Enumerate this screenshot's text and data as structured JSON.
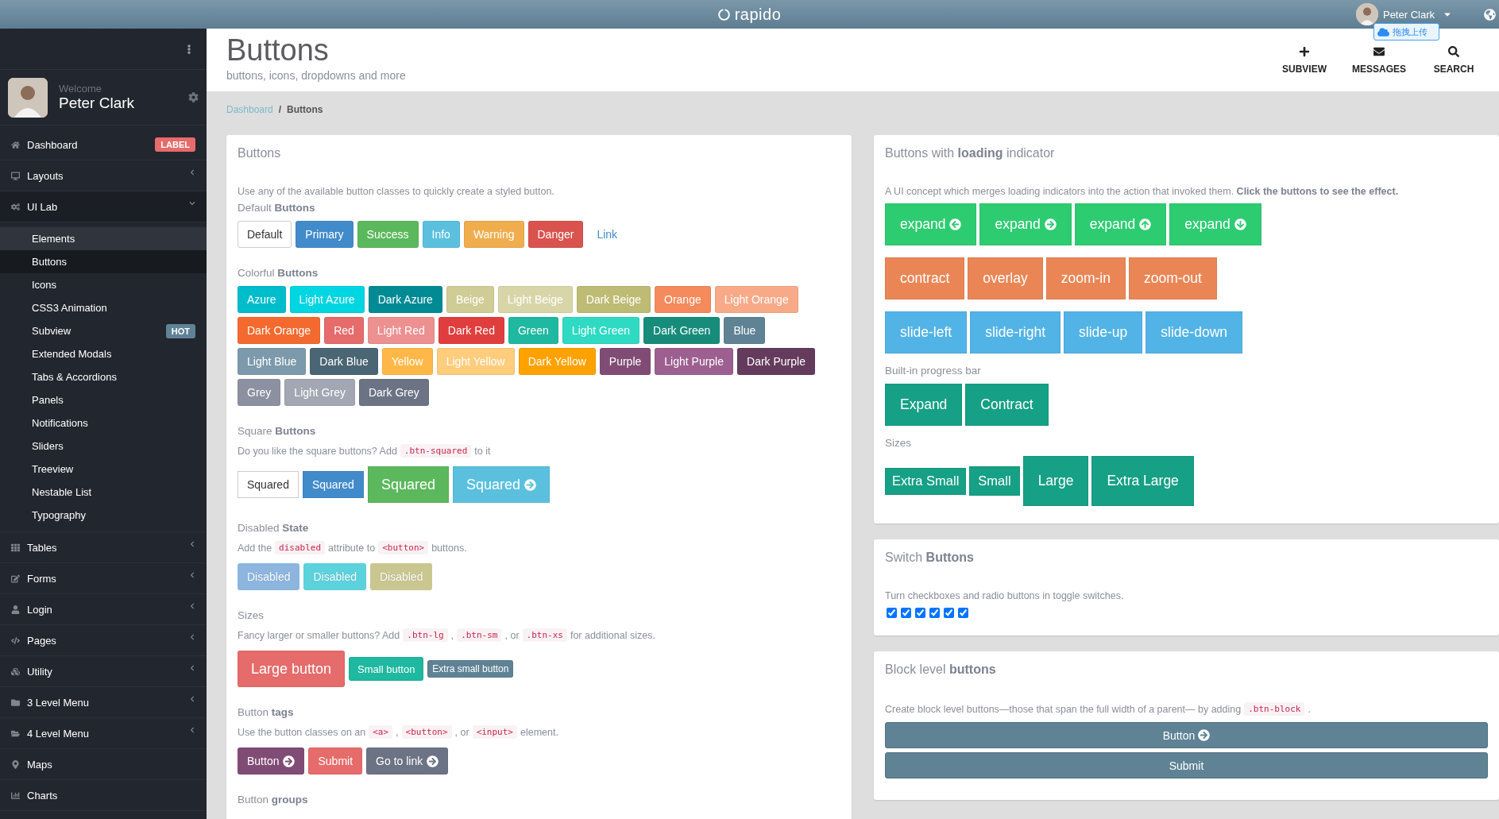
{
  "topbar": {
    "logo": "rapido",
    "user": "Peter Clark",
    "upload": "拖拽上传"
  },
  "sidebar": {
    "welcome": "Welcome",
    "user": "Peter Clark",
    "items": [
      {
        "label": "Dashboard",
        "badge": {
          "text": "LABEL",
          "color": "#e66b6b"
        }
      },
      {
        "label": "Layouts",
        "expanded": false
      },
      {
        "label": "UI Lab",
        "expanded": true,
        "children": [
          {
            "label": "Elements",
            "selected": false,
            "hovered": true
          },
          {
            "label": "Buttons",
            "selected": true,
            "hovered": false
          },
          {
            "label": "Icons",
            "selected": false,
            "hovered": false
          },
          {
            "label": "CSS3 Animation",
            "selected": false,
            "hovered": false
          },
          {
            "label": "Subview",
            "selected": false,
            "hovered": false,
            "badge": {
              "text": "HOT",
              "color": "#5f8295"
            }
          },
          {
            "label": "Extended Modals",
            "selected": false,
            "hovered": false
          },
          {
            "label": "Tabs & Accordions",
            "selected": false,
            "hovered": false
          },
          {
            "label": "Panels",
            "selected": false,
            "hovered": false
          },
          {
            "label": "Notifications",
            "selected": false,
            "hovered": false
          },
          {
            "label": "Sliders",
            "selected": false,
            "hovered": false
          },
          {
            "label": "Treeview",
            "selected": false,
            "hovered": false
          },
          {
            "label": "Nestable List",
            "selected": false,
            "hovered": false
          },
          {
            "label": "Typography",
            "selected": false,
            "hovered": false
          }
        ]
      },
      {
        "label": "Tables",
        "expanded": false
      },
      {
        "label": "Forms",
        "expanded": false
      },
      {
        "label": "Login",
        "expanded": false
      },
      {
        "label": "Pages",
        "expanded": false
      },
      {
        "label": "Utility",
        "expanded": false
      },
      {
        "label": "3 Level Menu",
        "expanded": false
      },
      {
        "label": "4 Level Menu",
        "expanded": false
      },
      {
        "label": "Maps"
      },
      {
        "label": "Charts"
      }
    ]
  },
  "header": {
    "title": "Buttons",
    "subtitle": "buttons, icons, dropdowns and more",
    "actions": [
      {
        "label": "SUBVIEW"
      },
      {
        "label": "MESSAGES"
      },
      {
        "label": "SEARCH"
      }
    ]
  },
  "breadcrumb": {
    "separator": "/",
    "items": [
      {
        "label": "Dashboard",
        "current": false
      },
      {
        "label": "Buttons",
        "current": true
      }
    ]
  },
  "columns": [
    [
      {
        "title": "Buttons",
        "intro": [
          {
            "kind": "text",
            "text": "Use any of the available button classes to quickly create a styled button."
          }
        ],
        "sections": [
          {
            "heading": "Default **Buttons**",
            "squared": false,
            "rows": [
              [
                {
                  "label": "Default",
                  "kind": "plain"
                },
                {
                  "label": "Primary",
                  "kind": "solid",
                  "color": "#428bca"
                },
                {
                  "label": "Success",
                  "kind": "solid",
                  "color": "#5cb85c"
                },
                {
                  "label": "Info",
                  "kind": "solid",
                  "color": "#5bc0de"
                },
                {
                  "label": "Warning",
                  "kind": "solid",
                  "color": "#f0ad4e"
                },
                {
                  "label": "Danger",
                  "kind": "solid",
                  "color": "#d9534f"
                },
                {
                  "label": "Link",
                  "kind": "link",
                  "color": "#428bca"
                }
              ]
            ]
          },
          {
            "heading": "Colorful **Buttons**",
            "squared": false,
            "rows": [
              [
                {
                  "label": "Azure",
                  "kind": "solid",
                  "color": "#00bdcc"
                },
                {
                  "label": "Light Azure",
                  "kind": "solid",
                  "color": "#00d5e2"
                },
                {
                  "label": "Dark Azure",
                  "kind": "solid",
                  "color": "#008b94"
                },
                {
                  "label": "Beige",
                  "kind": "solid",
                  "color": "#cfcc95"
                },
                {
                  "label": "Light Beige",
                  "kind": "solid",
                  "color": "#d8d6a8"
                },
                {
                  "label": "Dark Beige",
                  "kind": "solid",
                  "color": "#bebb74"
                },
                {
                  "label": "Orange",
                  "kind": "solid",
                  "color": "#f58a5c"
                },
                {
                  "label": "Light Orange",
                  "kind": "solid",
                  "color": "#f8aa88"
                }
              ],
              [
                {
                  "label": "Dark Orange",
                  "kind": "solid",
                  "color": "#f46a2e"
                },
                {
                  "label": "Red",
                  "kind": "solid",
                  "color": "#e66b6b"
                },
                {
                  "label": "Light Red",
                  "kind": "solid",
                  "color": "#ec9090"
                },
                {
                  "label": "Dark Red",
                  "kind": "solid",
                  "color": "#e03e3e"
                },
                {
                  "label": "Green",
                  "kind": "solid",
                  "color": "#1fb8a0"
                },
                {
                  "label": "Light Green",
                  "kind": "solid",
                  "color": "#2fdac3"
                },
                {
                  "label": "Dark Green",
                  "kind": "solid",
                  "color": "#178c7b"
                },
                {
                  "label": "Blue",
                  "kind": "solid",
                  "color": "#5f8295"
                }
              ],
              [
                {
                  "label": "Light Blue",
                  "kind": "solid",
                  "color": "#7c9aab"
                },
                {
                  "label": "Dark Blue",
                  "kind": "solid",
                  "color": "#4a6573"
                },
                {
                  "label": "Yellow",
                  "kind": "solid",
                  "color": "#ffb848"
                },
                {
                  "label": "Light Yellow",
                  "kind": "solid",
                  "color": "#ffcd7c"
                },
                {
                  "label": "Dark Yellow",
                  "kind": "solid",
                  "color": "#ffa200"
                },
                {
                  "label": "Purple",
                  "kind": "solid",
                  "color": "#804c75"
                },
                {
                  "label": "Light Purple",
                  "kind": "solid",
                  "color": "#9c5f90"
                },
                {
                  "label": "Dark Purple",
                  "kind": "solid",
                  "color": "#643b5c"
                }
              ],
              [
                {
                  "label": "Grey",
                  "kind": "solid",
                  "color": "#8b91a0"
                },
                {
                  "label": "Light Grey",
                  "kind": "solid",
                  "color": "#a2a7b3"
                },
                {
                  "label": "Dark Grey",
                  "kind": "solid",
                  "color": "#6c7385"
                }
              ]
            ]
          },
          {
            "heading": "Square **Buttons**",
            "note": [
              {
                "kind": "text",
                "text": "Do you like the square buttons? Add"
              },
              {
                "kind": "code",
                "text": ".btn-squared"
              },
              {
                "kind": "text",
                "text": "to it"
              }
            ],
            "squared": true,
            "rows": [
              [
                {
                  "label": "Squared",
                  "kind": "plain"
                },
                {
                  "label": "Squared",
                  "kind": "solid",
                  "color": "#428bca"
                },
                {
                  "label": "Squared",
                  "kind": "large",
                  "color": "#5cb85c"
                },
                {
                  "label": "Squared",
                  "kind": "largearrow",
                  "color": "#5bc0de"
                }
              ]
            ]
          },
          {
            "heading": "Disabled **State**",
            "note": [
              {
                "kind": "text",
                "text": "Add the"
              },
              {
                "kind": "code",
                "text": "disabled"
              },
              {
                "kind": "text",
                "text": "attribute to"
              },
              {
                "kind": "code",
                "text": "<button>"
              },
              {
                "kind": "text",
                "text": "buttons."
              }
            ],
            "squared": false,
            "rows": [
              [
                {
                  "label": "Disabled",
                  "kind": "solid",
                  "color": "#8cb5df",
                  "disabled": true
                },
                {
                  "label": "Disabled",
                  "kind": "solid",
                  "color": "#5bd2dc",
                  "disabled": true
                },
                {
                  "label": "Disabled",
                  "kind": "solid",
                  "color": "#c9c690",
                  "disabled": true
                }
              ]
            ]
          },
          {
            "heading": "Sizes",
            "note": [
              {
                "kind": "text",
                "text": "Fancy larger or smaller buttons? Add"
              },
              {
                "kind": "code",
                "text": ".btn-lg"
              },
              {
                "kind": "text",
                "text": ","
              },
              {
                "kind": "code",
                "text": ".btn-sm"
              },
              {
                "kind": "text",
                "text": ", or"
              },
              {
                "kind": "code",
                "text": ".btn-xs"
              },
              {
                "kind": "text",
                "text": "for additional sizes."
              }
            ],
            "squared": false,
            "rows": [
              [
                {
                  "label": "Large button",
                  "kind": "large",
                  "color": "#e66b6b"
                },
                {
                  "label": "Small button",
                  "kind": "small",
                  "color": "#1fb8a0"
                },
                {
                  "label": "Extra small button",
                  "kind": "mini",
                  "color": "#5f8295"
                }
              ]
            ]
          },
          {
            "heading": "Button **tags**",
            "note": [
              {
                "kind": "text",
                "text": "Use the button classes on an"
              },
              {
                "kind": "code",
                "text": "<a>"
              },
              {
                "kind": "text",
                "text": ","
              },
              {
                "kind": "code",
                "text": "<button>"
              },
              {
                "kind": "text",
                "text": ", or"
              },
              {
                "kind": "code",
                "text": "<input>"
              },
              {
                "kind": "text",
                "text": "element."
              }
            ],
            "squared": false,
            "rows": [
              [
                {
                  "label": "Button",
                  "kind": "arrow",
                  "color": "#804c75"
                },
                {
                  "label": "Submit",
                  "kind": "solid",
                  "color": "#e66b6b"
                },
                {
                  "label": "Go to link",
                  "kind": "arrow",
                  "color": "#6c7385"
                }
              ]
            ]
          },
          {
            "heading": "Button **groups**"
          }
        ]
      }
    ],
    [
      {
        "title": "Buttons with **loading** indicator",
        "intro": [
          {
            "kind": "text",
            "text": "A UI concept which merges loading indicators into the action that invoked them. **Click the buttons to see the effect.**"
          }
        ],
        "sections": [
          {
            "squared": true,
            "rows": [
              [
                {
                  "label": "expand",
                  "kind": "loaderarrow",
                  "color": "#2ecc71"
                },
                {
                  "label": "expand",
                  "kind": "loaderarrow",
                  "color": "#2ecc71"
                },
                {
                  "label": "expand",
                  "kind": "loaderarrow",
                  "color": "#2ecc71"
                },
                {
                  "label": "expand",
                  "kind": "loaderarrow",
                  "color": "#2ecc71"
                }
              ],
              [
                {
                  "label": "contract",
                  "kind": "loader",
                  "color": "#ea8655"
                },
                {
                  "label": "overlay",
                  "kind": "loader",
                  "color": "#ea8655"
                },
                {
                  "label": "zoom-in",
                  "kind": "loader",
                  "color": "#ea8655"
                },
                {
                  "label": "zoom-out",
                  "kind": "loader",
                  "color": "#ea8655"
                }
              ],
              [
                {
                  "label": "slide-left",
                  "kind": "loader",
                  "color": "#52b3e6"
                },
                {
                  "label": "slide-right",
                  "kind": "loader",
                  "color": "#52b3e6"
                },
                {
                  "label": "slide-up",
                  "kind": "loader",
                  "color": "#52b3e6"
                },
                {
                  "label": "slide-down",
                  "kind": "loader",
                  "color": "#52b3e6"
                }
              ]
            ]
          },
          {
            "heading": "Built-in progress bar",
            "squared": true,
            "rows": [
              [
                {
                  "label": "Expand",
                  "kind": "loader",
                  "color": "#16a085"
                },
                {
                  "label": "Contract",
                  "kind": "loader",
                  "color": "#16a085"
                }
              ]
            ]
          },
          {
            "heading": "Sizes",
            "squared": true,
            "rows": [
              [
                {
                  "label": "Extra Small",
                  "kind": "loaderxs",
                  "color": "#16a085"
                },
                {
                  "label": "Small",
                  "kind": "loadersm",
                  "color": "#16a085"
                },
                {
                  "label": "Large",
                  "kind": "loaderlg",
                  "color": "#16a085"
                },
                {
                  "label": "Extra Large",
                  "kind": "loaderlg",
                  "color": "#16a085"
                }
              ]
            ]
          }
        ]
      },
      {
        "title": "Switch **Buttons**",
        "intro": [
          {
            "kind": "text",
            "text": "Turn checkboxes and radio buttons in toggle switches."
          }
        ],
        "checkboxes": [
          {
            "checked": true
          },
          {
            "checked": true
          },
          {
            "checked": true
          },
          {
            "checked": true
          },
          {
            "checked": true
          },
          {
            "checked": true
          }
        ]
      },
      {
        "title": "Block level **buttons**",
        "intro": [
          {
            "kind": "text",
            "text": "Create block level buttons—those that span the full width of a parent— by adding"
          },
          {
            "kind": "code",
            "text": ".btn-block"
          },
          {
            "kind": "text",
            "text": "."
          }
        ],
        "blocks": [
          {
            "label": "Button",
            "kind": "arrow"
          },
          {
            "label": "Submit",
            "kind": "text"
          }
        ]
      }
    ]
  ]
}
